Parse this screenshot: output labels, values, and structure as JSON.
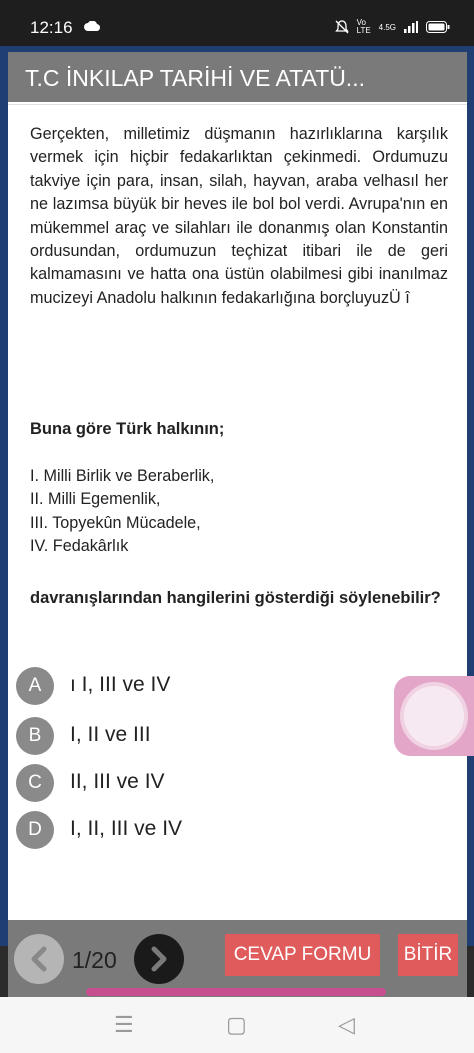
{
  "status": {
    "time": "12:16",
    "network": "4.5G",
    "indicators": "Vo LTE"
  },
  "dialog": {
    "title": "T.C İNKILAP TARİHİ VE ATATÜ..."
  },
  "question": {
    "passage": "Gerçekten, milletimiz düşmanın hazırlıklarına karşılık vermek için hiçbir fedakarlıktan çekinmedi. Ordumuzu takviye için para, insan, silah, hayvan, araba velhasıl her ne lazımsa büyük bir heves ile bol bol verdi. Avrupa'nın en mükemmel araç ve silahları ile donanmış olan Konstantin ordusundan, ordumuzun teçhizat itibari ile de geri kalmamasını ve hatta ona üstün olabilmesi gibi inanılmaz mucizeyi Anadolu halkının fedakarlığına borçluyuzÜ î",
    "stem": "Buna göre Türk halkının;",
    "items": [
      "I. Milli Birlik ve Beraberlik,",
      "II. Milli Egemenlik,",
      "III. Topyekûn Mücadele,",
      "IV. Fedakârlık"
    ],
    "prompt": "davranışlarından hangilerini gösterdiği söylenebilir?"
  },
  "options": [
    {
      "letter": "A",
      "text": "ı I, III ve IV"
    },
    {
      "letter": "B",
      "text": "I, II ve III"
    },
    {
      "letter": "C",
      "text": "II, III ve IV"
    },
    {
      "letter": "D",
      "text": "I, II, III ve IV"
    }
  ],
  "footer": {
    "page": "1/20",
    "answer_form": "CEVAP FORMU",
    "finish": "BİTİR"
  },
  "colors": {
    "titlebar": "#7a7a7a",
    "option_circle": "#8a8a8a",
    "action_button": "#e05b5b",
    "float_button": "#e3a6c8"
  }
}
